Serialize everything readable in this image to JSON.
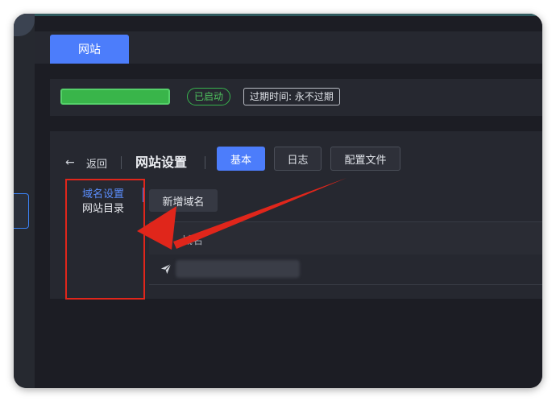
{
  "tabs": {
    "site": "网站"
  },
  "status": {
    "site_name_value": "",
    "running_badge": "已启动",
    "expire_badge": "过期时间: 永不过期"
  },
  "settings": {
    "back_label": "返回",
    "title": "网站设置",
    "chips": {
      "basic": "基本",
      "logs": "日志",
      "config_file": "配置文件"
    },
    "menu": [
      {
        "label": "域名设置",
        "active": true
      },
      {
        "label": "网站目录",
        "active": false
      }
    ],
    "add_domain": "新增域名",
    "table": {
      "columns": [
        "域名"
      ],
      "rows": [
        {
          "domain": ""
        }
      ]
    }
  },
  "colors": {
    "accent": "#4c7dfb",
    "running": "#37b24d",
    "annotation": "#e0261b",
    "background": "#1c1d24"
  },
  "icons": {
    "back": "arrow-left-icon",
    "row_type": "send-icon"
  }
}
